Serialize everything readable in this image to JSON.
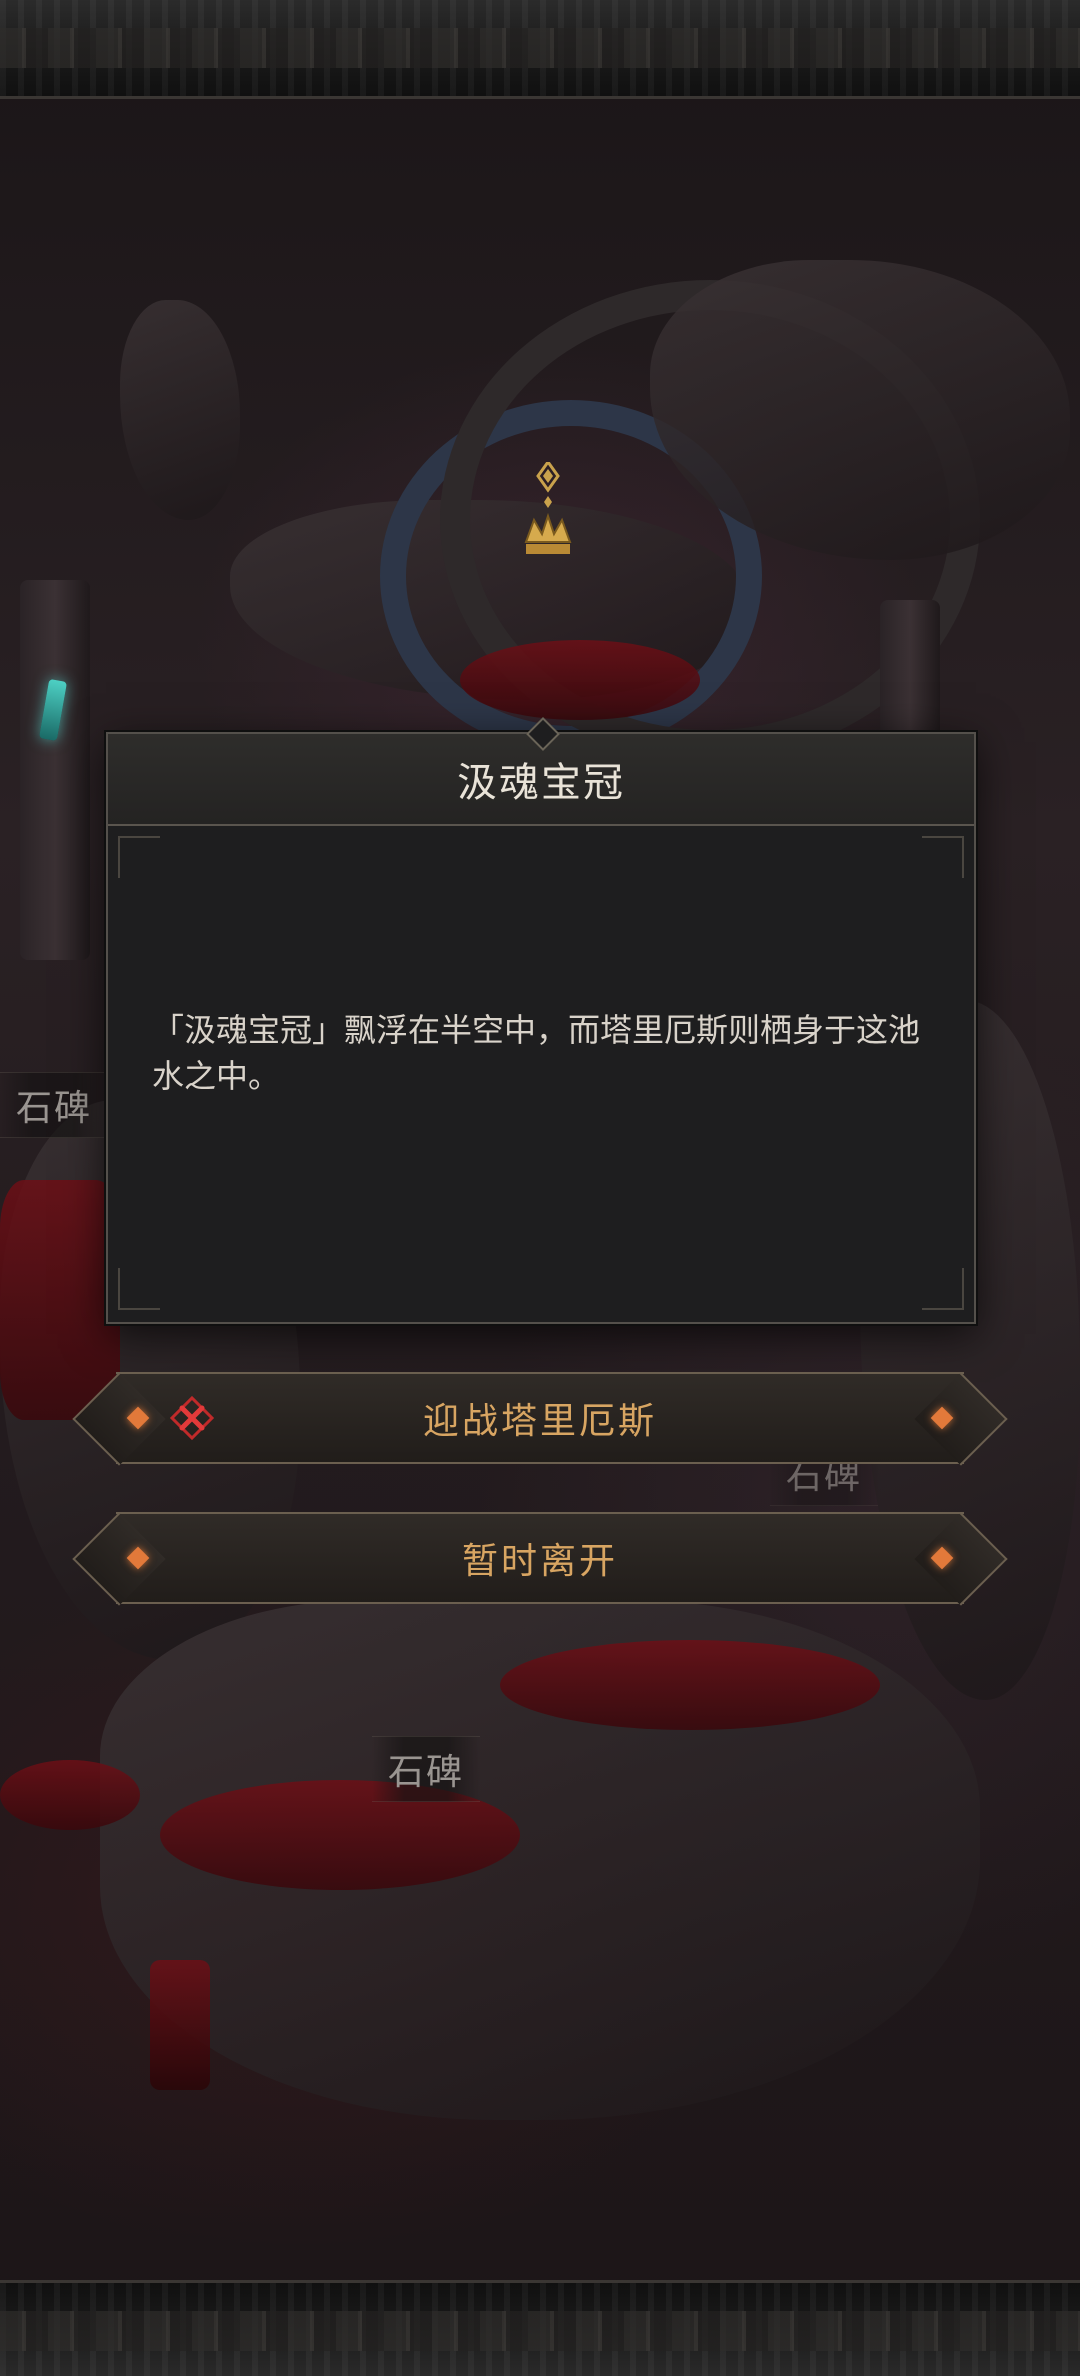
{
  "map": {
    "labels": [
      "石碑",
      "石碑",
      "石碑"
    ]
  },
  "dialog": {
    "title": "汲魂宝冠",
    "body": "「汲魂宝冠」飘浮在半空中，而塔里厄斯则栖身于这池水之中。"
  },
  "options": [
    {
      "label": "迎战塔里厄斯",
      "icon": "crossed-swords-icon"
    },
    {
      "label": "暂时离开",
      "icon": ""
    }
  ],
  "colors": {
    "option_text": "#d8a562",
    "accent_gem": "#e2793a",
    "blood": "#6d0f16"
  }
}
